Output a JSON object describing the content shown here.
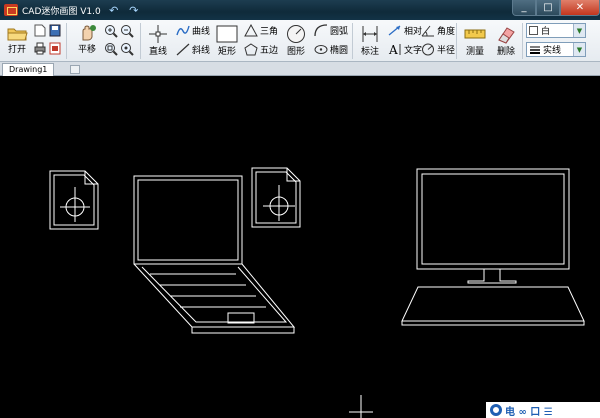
{
  "app": {
    "title": "CAD迷你画图 V1.0",
    "undo_icon": "undo-icon",
    "redo_icon": "redo-icon",
    "window_buttons": [
      "minimize-icon",
      "maximize-icon",
      "close-icon"
    ]
  },
  "ribbon": {
    "open_label": "打开",
    "pan_label": "平移",
    "line_label": "直线",
    "curve_label": "曲线",
    "slant_label": "斜线",
    "rect_label": "矩形",
    "triangle_label": "三角",
    "pentagon_label": "五边",
    "shape_label": "图形",
    "arc_label": "圆弧",
    "ellipse_label": "椭圆",
    "dimension_label": "标注",
    "relative_label": "相对",
    "angle_label": "角度",
    "text_label": "文字",
    "radius_label": "半径",
    "measure_label": "测量",
    "delete_label": "删除",
    "color_value": "白",
    "linetype_value": "实线"
  },
  "tabs": [
    {
      "label": "Drawing1",
      "active": true
    }
  ],
  "canvas": {
    "background": "#000000",
    "stroke": "#ffffff",
    "objects": [
      "document-symbol-left",
      "laptop",
      "document-symbol-middle",
      "desktop-monitor"
    ]
  },
  "watermark": {
    "text": "电 ∞ 口 ☰"
  }
}
